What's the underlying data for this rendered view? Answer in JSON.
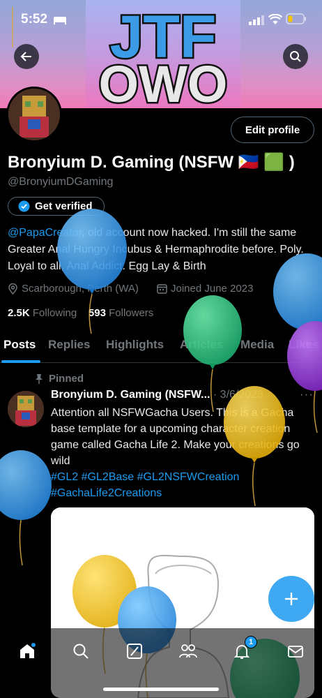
{
  "status": {
    "time": "5:52"
  },
  "banner": {
    "line1": "JTF",
    "line2": "OWO"
  },
  "header": {
    "back_icon": "arrow-left-icon",
    "search_icon": "search-icon"
  },
  "profile": {
    "edit_label": "Edit profile",
    "name": "Bronyium D. Gaming (NSFW 🇵🇭 🟩 )",
    "handle": "@BronyiumDGaming",
    "verify_label": "Get verified",
    "bio_mention": "@PapaCreator",
    "bio_text": ", old account now hacked. I'm still the same Greater Anal Hungry Incubus & Hermaphrodite before. Poly. Loyal to all, Anal Addict. Egg Lay & Birth",
    "location": "Scarborough, Perth (WA)",
    "joined": "Joined June 2023",
    "following_count": "2.5K",
    "following_label": "Following",
    "followers_count": "593",
    "followers_label": "Followers"
  },
  "tabs": [
    "Posts",
    "Replies",
    "Highlights",
    "Articles",
    "Media",
    "Likes"
  ],
  "post": {
    "pinned_label": "Pinned",
    "author": "Bronyium D. Gaming (NSFW...",
    "date": "· 3/6/2023",
    "text": "Attention all NSFWGacha Users. This is a Gacha base template for a upcoming character creation game called Gacha Life 2. Make your creations go wild",
    "hashtags_line1": "#GL2 #GL2Base #GL2NSFWCreation",
    "hashtags_line2": "#GachaLife2Creations",
    "more": "···"
  },
  "nav": {
    "items": [
      "home-icon",
      "search-icon",
      "grok-icon",
      "communities-icon",
      "bell-icon",
      "mail-icon"
    ],
    "notification_badge": "1"
  },
  "colors": {
    "accent": "#1d9bf0",
    "background": "#000000",
    "muted": "#71767b"
  }
}
